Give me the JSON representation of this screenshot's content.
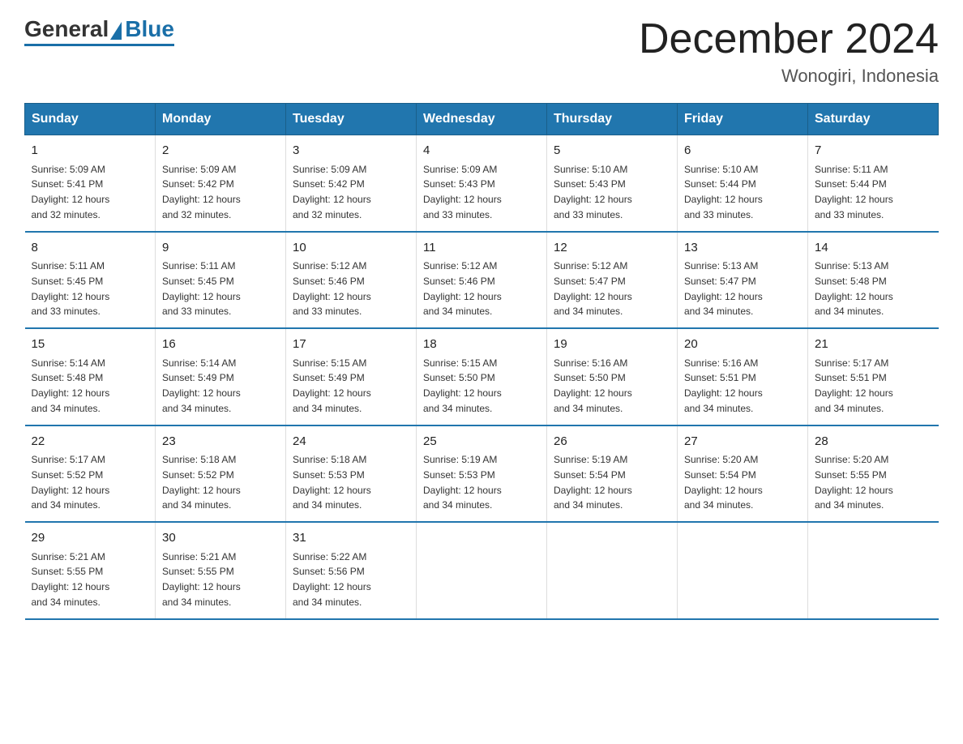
{
  "logo": {
    "text_general": "General",
    "text_blue": "Blue"
  },
  "title": "December 2024",
  "location": "Wonogiri, Indonesia",
  "days_of_week": [
    "Sunday",
    "Monday",
    "Tuesday",
    "Wednesday",
    "Thursday",
    "Friday",
    "Saturday"
  ],
  "weeks": [
    [
      {
        "day": "1",
        "sunrise": "5:09 AM",
        "sunset": "5:41 PM",
        "daylight": "12 hours and 32 minutes."
      },
      {
        "day": "2",
        "sunrise": "5:09 AM",
        "sunset": "5:42 PM",
        "daylight": "12 hours and 32 minutes."
      },
      {
        "day": "3",
        "sunrise": "5:09 AM",
        "sunset": "5:42 PM",
        "daylight": "12 hours and 32 minutes."
      },
      {
        "day": "4",
        "sunrise": "5:09 AM",
        "sunset": "5:43 PM",
        "daylight": "12 hours and 33 minutes."
      },
      {
        "day": "5",
        "sunrise": "5:10 AM",
        "sunset": "5:43 PM",
        "daylight": "12 hours and 33 minutes."
      },
      {
        "day": "6",
        "sunrise": "5:10 AM",
        "sunset": "5:44 PM",
        "daylight": "12 hours and 33 minutes."
      },
      {
        "day": "7",
        "sunrise": "5:11 AM",
        "sunset": "5:44 PM",
        "daylight": "12 hours and 33 minutes."
      }
    ],
    [
      {
        "day": "8",
        "sunrise": "5:11 AM",
        "sunset": "5:45 PM",
        "daylight": "12 hours and 33 minutes."
      },
      {
        "day": "9",
        "sunrise": "5:11 AM",
        "sunset": "5:45 PM",
        "daylight": "12 hours and 33 minutes."
      },
      {
        "day": "10",
        "sunrise": "5:12 AM",
        "sunset": "5:46 PM",
        "daylight": "12 hours and 33 minutes."
      },
      {
        "day": "11",
        "sunrise": "5:12 AM",
        "sunset": "5:46 PM",
        "daylight": "12 hours and 34 minutes."
      },
      {
        "day": "12",
        "sunrise": "5:12 AM",
        "sunset": "5:47 PM",
        "daylight": "12 hours and 34 minutes."
      },
      {
        "day": "13",
        "sunrise": "5:13 AM",
        "sunset": "5:47 PM",
        "daylight": "12 hours and 34 minutes."
      },
      {
        "day": "14",
        "sunrise": "5:13 AM",
        "sunset": "5:48 PM",
        "daylight": "12 hours and 34 minutes."
      }
    ],
    [
      {
        "day": "15",
        "sunrise": "5:14 AM",
        "sunset": "5:48 PM",
        "daylight": "12 hours and 34 minutes."
      },
      {
        "day": "16",
        "sunrise": "5:14 AM",
        "sunset": "5:49 PM",
        "daylight": "12 hours and 34 minutes."
      },
      {
        "day": "17",
        "sunrise": "5:15 AM",
        "sunset": "5:49 PM",
        "daylight": "12 hours and 34 minutes."
      },
      {
        "day": "18",
        "sunrise": "5:15 AM",
        "sunset": "5:50 PM",
        "daylight": "12 hours and 34 minutes."
      },
      {
        "day": "19",
        "sunrise": "5:16 AM",
        "sunset": "5:50 PM",
        "daylight": "12 hours and 34 minutes."
      },
      {
        "day": "20",
        "sunrise": "5:16 AM",
        "sunset": "5:51 PM",
        "daylight": "12 hours and 34 minutes."
      },
      {
        "day": "21",
        "sunrise": "5:17 AM",
        "sunset": "5:51 PM",
        "daylight": "12 hours and 34 minutes."
      }
    ],
    [
      {
        "day": "22",
        "sunrise": "5:17 AM",
        "sunset": "5:52 PM",
        "daylight": "12 hours and 34 minutes."
      },
      {
        "day": "23",
        "sunrise": "5:18 AM",
        "sunset": "5:52 PM",
        "daylight": "12 hours and 34 minutes."
      },
      {
        "day": "24",
        "sunrise": "5:18 AM",
        "sunset": "5:53 PM",
        "daylight": "12 hours and 34 minutes."
      },
      {
        "day": "25",
        "sunrise": "5:19 AM",
        "sunset": "5:53 PM",
        "daylight": "12 hours and 34 minutes."
      },
      {
        "day": "26",
        "sunrise": "5:19 AM",
        "sunset": "5:54 PM",
        "daylight": "12 hours and 34 minutes."
      },
      {
        "day": "27",
        "sunrise": "5:20 AM",
        "sunset": "5:54 PM",
        "daylight": "12 hours and 34 minutes."
      },
      {
        "day": "28",
        "sunrise": "5:20 AM",
        "sunset": "5:55 PM",
        "daylight": "12 hours and 34 minutes."
      }
    ],
    [
      {
        "day": "29",
        "sunrise": "5:21 AM",
        "sunset": "5:55 PM",
        "daylight": "12 hours and 34 minutes."
      },
      {
        "day": "30",
        "sunrise": "5:21 AM",
        "sunset": "5:55 PM",
        "daylight": "12 hours and 34 minutes."
      },
      {
        "day": "31",
        "sunrise": "5:22 AM",
        "sunset": "5:56 PM",
        "daylight": "12 hours and 34 minutes."
      },
      null,
      null,
      null,
      null
    ]
  ],
  "labels": {
    "sunrise": "Sunrise:",
    "sunset": "Sunset:",
    "daylight": "Daylight:"
  },
  "colors": {
    "header_bg": "#2176ae",
    "accent": "#1a6fa8"
  }
}
